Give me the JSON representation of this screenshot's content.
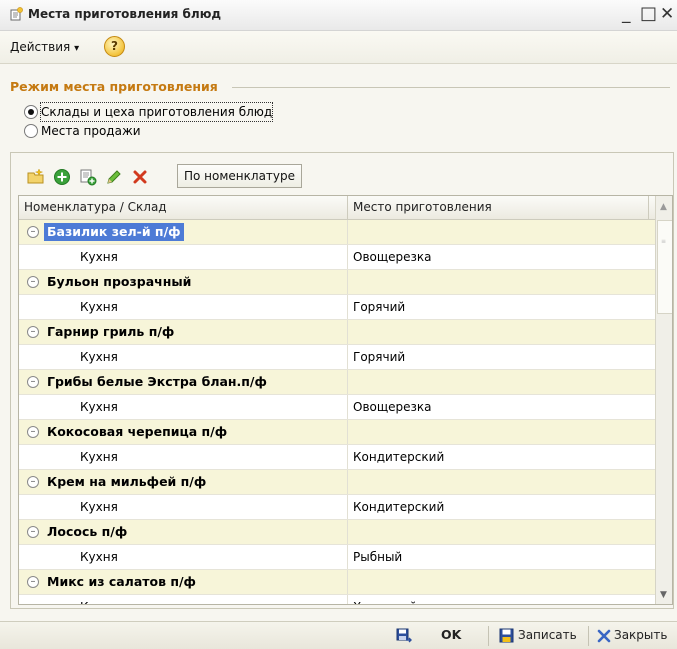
{
  "window": {
    "title": "Места приготовления блюд",
    "minimize": "_",
    "maximize": "□",
    "close": "✕"
  },
  "menu": {
    "actions_label": "Действия",
    "actions_arrow": "▾",
    "help_label": "?"
  },
  "mode_group": {
    "title": "Режим места приготовления",
    "options": [
      {
        "label": "Склады и цеха приготовления блюд",
        "selected": true
      },
      {
        "label": "Места продажи",
        "selected": false
      }
    ]
  },
  "toolbar": {
    "icons": [
      "new-folder-icon",
      "add-icon",
      "copy-icon",
      "edit-icon",
      "delete-icon"
    ],
    "by_nomenclature_label": "По номенклатуре"
  },
  "grid": {
    "columns": [
      "Номенклатура / Склад",
      "Место приготовления"
    ],
    "groups": [
      {
        "name": "Базилик зел-й п/ф",
        "selected": true,
        "child": {
          "name": "Кухня",
          "place": "Овощерезка"
        }
      },
      {
        "name": "Бульон прозрачный",
        "selected": false,
        "child": {
          "name": "Кухня",
          "place": "Горячий"
        }
      },
      {
        "name": "Гарнир гриль п/ф",
        "selected": false,
        "child": {
          "name": "Кухня",
          "place": "Горячий"
        }
      },
      {
        "name": "Грибы белые Экстра блан.п/ф",
        "selected": false,
        "child": {
          "name": "Кухня",
          "place": "Овощерезка"
        }
      },
      {
        "name": "Кокосовая черепица п/ф",
        "selected": false,
        "child": {
          "name": "Кухня",
          "place": "Кондитерский"
        }
      },
      {
        "name": "Крем на мильфей п/ф",
        "selected": false,
        "child": {
          "name": "Кухня",
          "place": "Кондитерский"
        }
      },
      {
        "name": "Лосось п/ф",
        "selected": false,
        "child": {
          "name": "Кухня",
          "place": "Рыбный"
        }
      },
      {
        "name": "Микс из салатов п/ф",
        "selected": false,
        "child": {
          "name": "Кухня",
          "place": "Холодный"
        }
      }
    ]
  },
  "bottom": {
    "ok_label": "OK",
    "save_label": "Записать",
    "close_label": "Закрыть"
  },
  "colors": {
    "group_title": "#c57a12",
    "group_row_bg": "#f7f5d9",
    "selection": "#4d7bd6",
    "delete_red": "#d23a1e",
    "add_green": "#3aa13a"
  }
}
